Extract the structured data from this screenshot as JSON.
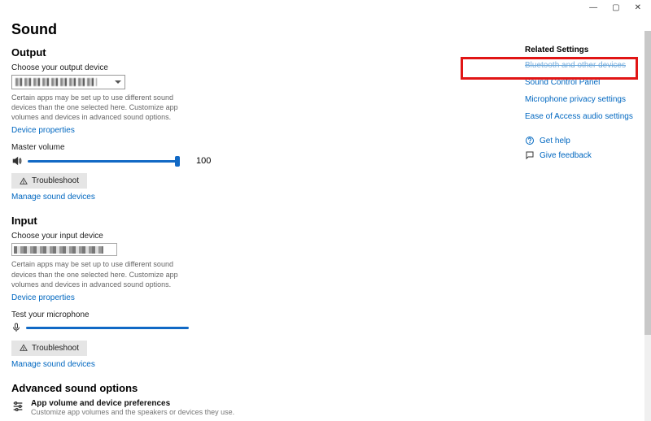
{
  "titlebar": {
    "min": "—",
    "max": "▢",
    "close": "✕"
  },
  "page": {
    "title": "Sound"
  },
  "output": {
    "heading": "Output",
    "choose_label": "Choose your output device",
    "hint": "Certain apps may be set up to use different sound devices than the one selected here. Customize app volumes and devices in advanced sound options.",
    "device_properties": "Device properties",
    "master_volume_label": "Master volume",
    "volume_value": "100",
    "volume_percent": 100,
    "troubleshoot": "Troubleshoot",
    "manage": "Manage sound devices"
  },
  "input": {
    "heading": "Input",
    "choose_label": "Choose your input device",
    "hint": "Certain apps may be set up to use different sound devices than the one selected here. Customize app volumes and devices in advanced sound options.",
    "device_properties": "Device properties",
    "test_label": "Test your microphone",
    "troubleshoot": "Troubleshoot",
    "manage": "Manage sound devices"
  },
  "advanced": {
    "heading": "Advanced sound options",
    "item_title": "App volume and device preferences",
    "item_sub": "Customize app volumes and the speakers or devices they use."
  },
  "side": {
    "heading": "Related Settings",
    "links": {
      "bt": "Bluetooth and other devices",
      "scp": "Sound Control Panel",
      "mic": "Microphone privacy settings",
      "eoa": "Ease of Access audio settings"
    },
    "gethelp": "Get help",
    "feedback": "Give feedback"
  }
}
